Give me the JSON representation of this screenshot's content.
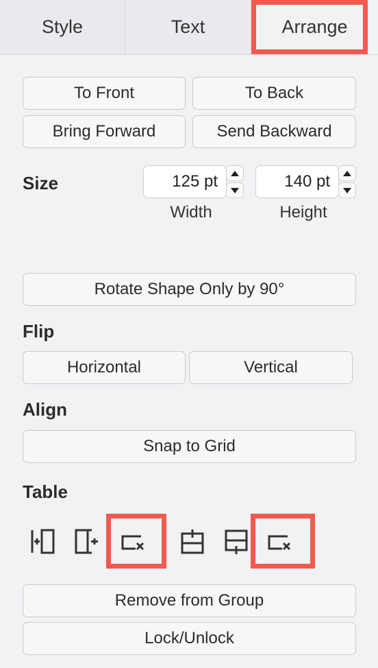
{
  "tabs": {
    "style": "Style",
    "text": "Text",
    "arrange": "Arrange"
  },
  "order": {
    "to_front": "To Front",
    "to_back": "To Back",
    "bring_forward": "Bring Forward",
    "send_backward": "Send Backward"
  },
  "size": {
    "label": "Size",
    "width_value": "125 pt",
    "height_value": "140 pt",
    "width_label": "Width",
    "height_label": "Height"
  },
  "rotate": {
    "label": "Rotate Shape Only by 90°"
  },
  "flip": {
    "label": "Flip",
    "horizontal": "Horizontal",
    "vertical": "Vertical"
  },
  "align": {
    "label": "Align",
    "snap": "Snap to Grid"
  },
  "table": {
    "label": "Table"
  },
  "group": {
    "remove": "Remove from Group",
    "lock": "Lock/Unlock"
  },
  "colors": {
    "highlight": "#f35a4f",
    "panel_bg": "#f1f2f4"
  }
}
